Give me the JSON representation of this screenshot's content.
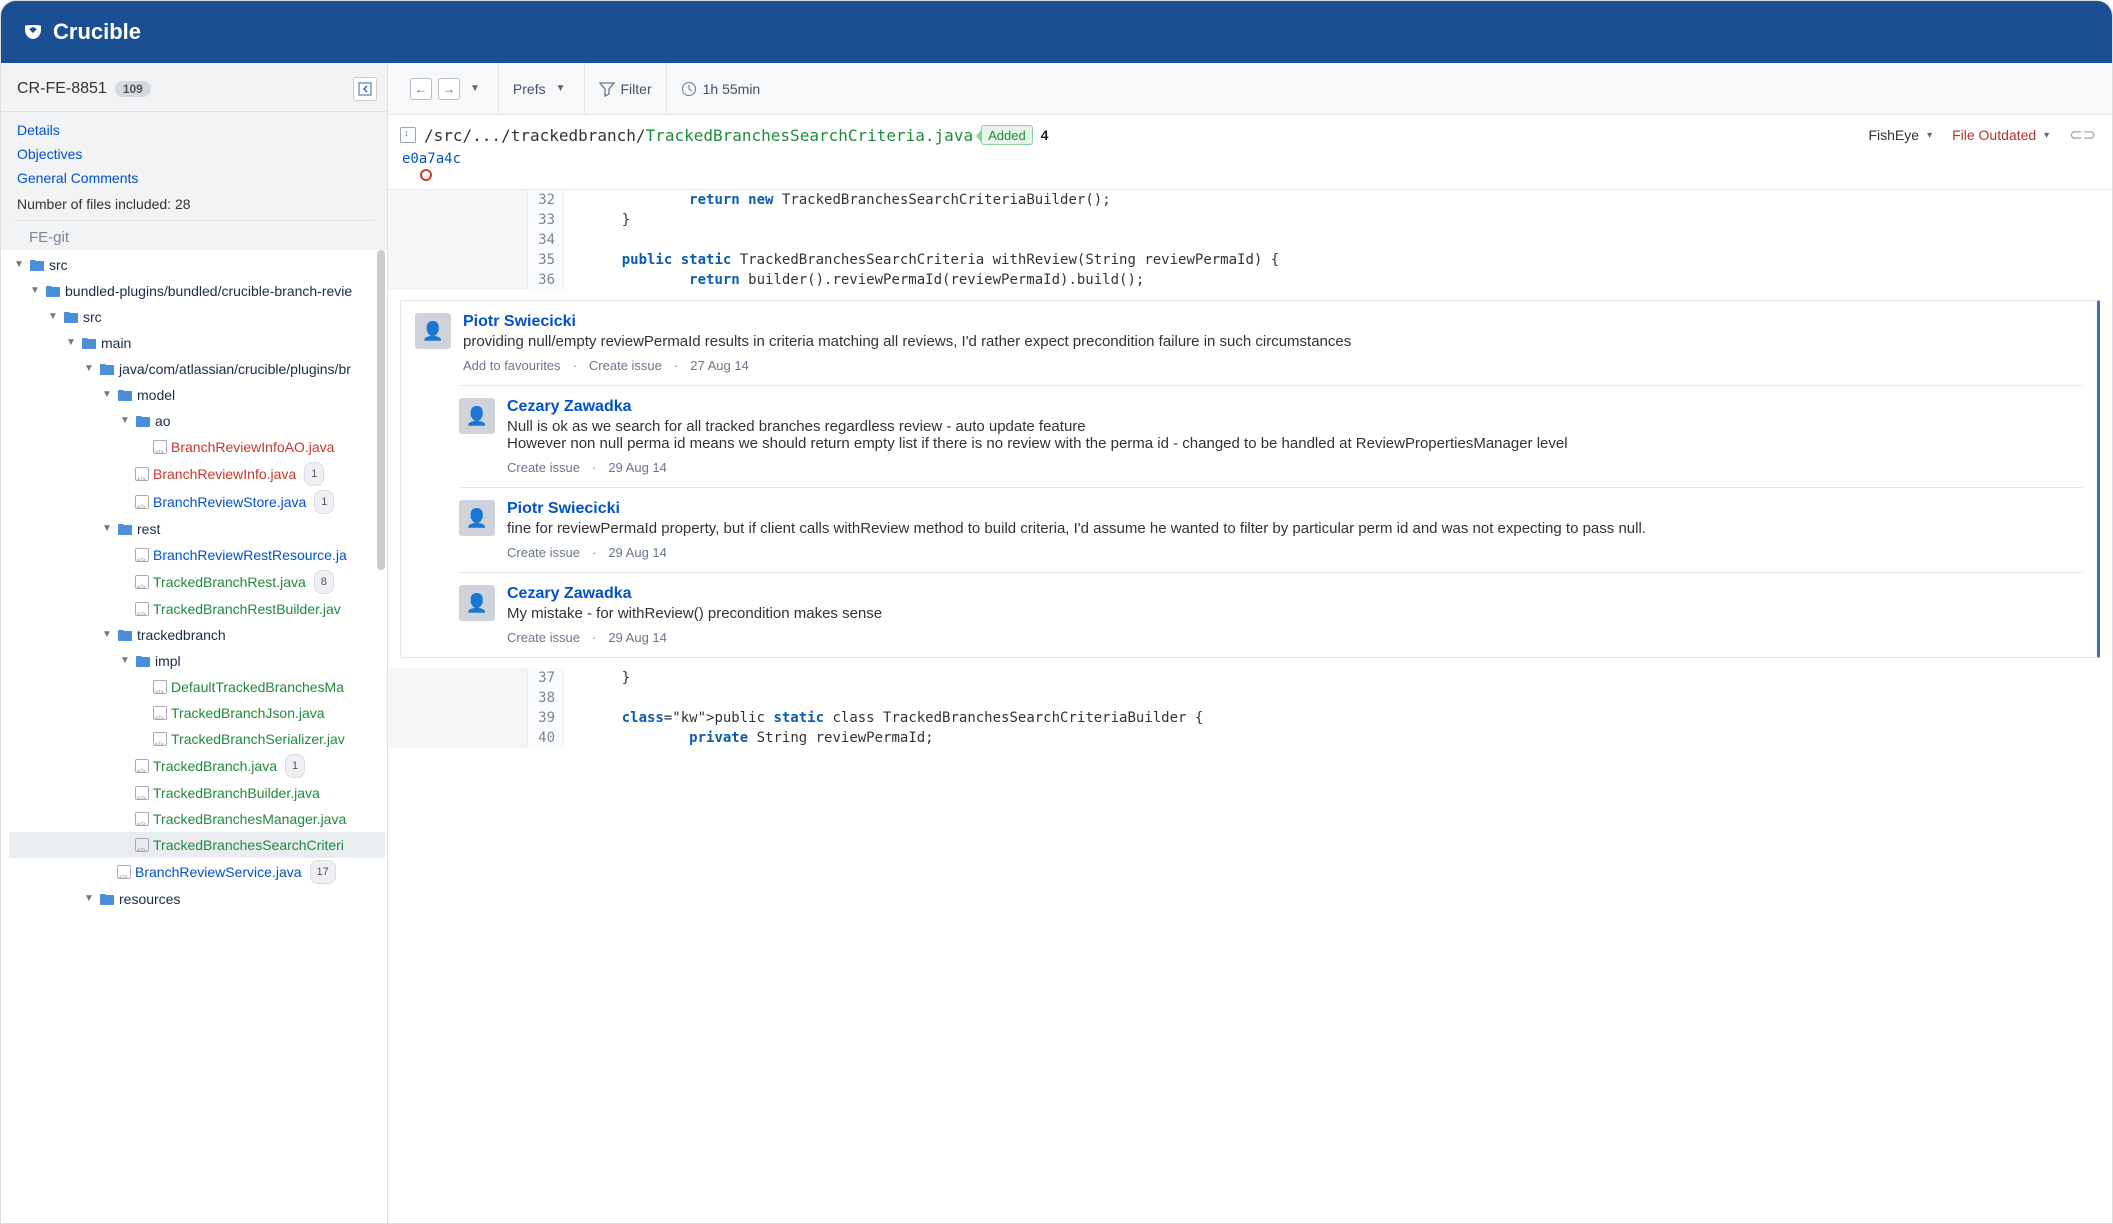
{
  "brand": "Crucible",
  "review": {
    "id": "CR-FE-8851",
    "count": "109"
  },
  "sidebar_links": {
    "details": "Details",
    "objectives": "Objectives",
    "general_comments": "General Comments"
  },
  "files_included": "Number of files included: 28",
  "repo_label": "FE-git",
  "toolbar": {
    "prefs": "Prefs",
    "filter": "Filter",
    "time": "1h 55min"
  },
  "file_header": {
    "path_prefix": "/src/.../trackedbranch/",
    "path_file": "TrackedBranchesSearchCriteria.java",
    "added_label": "Added",
    "comment_count": "4",
    "fisheye": "FishEye",
    "outdated": "File Outdated",
    "commit": "e0a7a4c"
  },
  "code_top": [
    {
      "n": "32",
      "text": "            return new TrackedBranchesSearchCriteriaBuilder();",
      "kw": [
        "return",
        "new"
      ]
    },
    {
      "n": "33",
      "text": "    }",
      "kw": []
    },
    {
      "n": "34",
      "text": "",
      "kw": []
    },
    {
      "n": "35",
      "text": "    public static TrackedBranchesSearchCriteria withReview(String reviewPermaId) {",
      "kw": [
        "public",
        "static"
      ]
    },
    {
      "n": "36",
      "text": "            return builder().reviewPermaId(reviewPermaId).build();",
      "kw": [
        "return"
      ]
    }
  ],
  "code_bottom": [
    {
      "n": "37",
      "text": "    }",
      "kw": []
    },
    {
      "n": "38",
      "text": "",
      "kw": []
    },
    {
      "n": "39",
      "text": "    public static class TrackedBranchesSearchCriteriaBuilder {",
      "kw": [
        "public",
        "static",
        "class"
      ]
    },
    {
      "n": "40",
      "text": "            private String reviewPermaId;",
      "kw": [
        "private"
      ]
    }
  ],
  "actions": {
    "add_fav": "Add to favourites",
    "create_issue": "Create issue"
  },
  "comments": [
    {
      "author": "Piotr Swiecicki",
      "text": "providing null/empty reviewPermaId results in criteria matching all reviews, I'd rather expect precondition failure in such circumstances",
      "date": "27 Aug 14",
      "top": true,
      "replies": [
        {
          "author": "Cezary Zawadka",
          "text": "Null is ok as we search for all tracked branches regardless review - auto update feature\nHowever non null perma id means we should return empty list if there is no review with the perma id - changed to be handled at ReviewPropertiesManager level",
          "date": "29 Aug 14",
          "replies": [
            {
              "author": "Piotr Swiecicki",
              "text": "fine for reviewPermaId property, but if client calls withReview method to build criteria, I'd assume he wanted to filter by particular perm id and was not expecting to pass null.",
              "date": "29 Aug 14",
              "replies": []
            },
            {
              "author": "Cezary Zawadka",
              "text": "My mistake - for withReview() precondition makes sense",
              "date": "29 Aug 14",
              "replies": []
            }
          ]
        }
      ]
    }
  ],
  "tree": [
    {
      "d": 0,
      "type": "folder",
      "open": true,
      "name": "src"
    },
    {
      "d": 1,
      "type": "folder",
      "open": true,
      "name": "bundled-plugins/bundled/crucible-branch-revie"
    },
    {
      "d": 2,
      "type": "folder",
      "open": true,
      "name": "src"
    },
    {
      "d": 3,
      "type": "folder",
      "open": true,
      "name": "main"
    },
    {
      "d": 4,
      "type": "folder",
      "open": true,
      "name": "java/com/atlassian/crucible/plugins/br"
    },
    {
      "d": 5,
      "type": "folder",
      "open": true,
      "name": "model"
    },
    {
      "d": 6,
      "type": "folder",
      "open": true,
      "name": "ao"
    },
    {
      "d": 7,
      "type": "file",
      "color": "red",
      "name": "BranchReviewInfoAO.java"
    },
    {
      "d": 6,
      "type": "file",
      "color": "red",
      "name": "BranchReviewInfo.java",
      "count": "1"
    },
    {
      "d": 6,
      "type": "file",
      "color": "blue",
      "name": "BranchReviewStore.java",
      "count": "1"
    },
    {
      "d": 5,
      "type": "folder",
      "open": true,
      "name": "rest"
    },
    {
      "d": 6,
      "type": "file",
      "color": "blue",
      "name": "BranchReviewRestResource.ja"
    },
    {
      "d": 6,
      "type": "file",
      "color": "green",
      "name": "TrackedBranchRest.java",
      "count": "8"
    },
    {
      "d": 6,
      "type": "file",
      "color": "green",
      "name": "TrackedBranchRestBuilder.jav"
    },
    {
      "d": 5,
      "type": "folder",
      "open": true,
      "name": "trackedbranch"
    },
    {
      "d": 6,
      "type": "folder",
      "open": true,
      "name": "impl"
    },
    {
      "d": 7,
      "type": "file",
      "color": "green",
      "name": "DefaultTrackedBranchesMa"
    },
    {
      "d": 7,
      "type": "file",
      "color": "green",
      "name": "TrackedBranchJson.java"
    },
    {
      "d": 7,
      "type": "file",
      "color": "green",
      "name": "TrackedBranchSerializer.jav"
    },
    {
      "d": 6,
      "type": "file",
      "color": "green",
      "name": "TrackedBranch.java",
      "count": "1"
    },
    {
      "d": 6,
      "type": "file",
      "color": "green",
      "name": "TrackedBranchBuilder.java"
    },
    {
      "d": 6,
      "type": "file",
      "color": "green",
      "name": "TrackedBranchesManager.java"
    },
    {
      "d": 6,
      "type": "file",
      "color": "green",
      "name": "TrackedBranchesSearchCriteri",
      "selected": true
    },
    {
      "d": 5,
      "type": "file",
      "color": "blue",
      "name": "BranchReviewService.java",
      "count": "17"
    },
    {
      "d": 4,
      "type": "folder",
      "open": true,
      "name": "resources"
    }
  ]
}
